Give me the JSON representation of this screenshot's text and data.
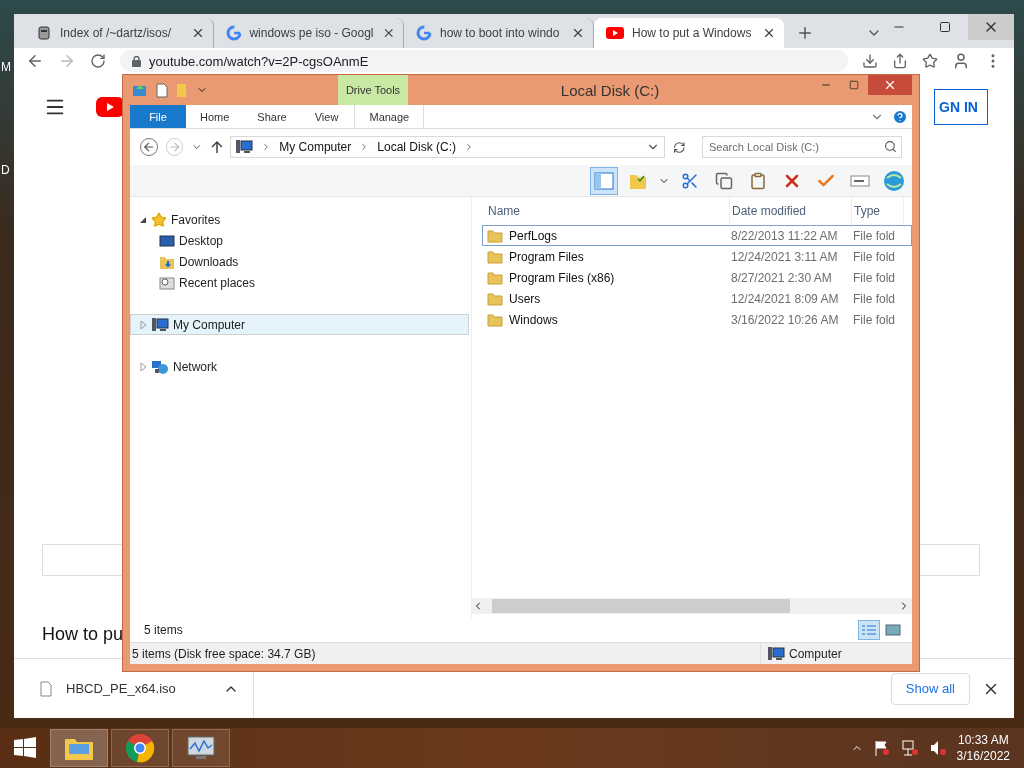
{
  "desktop_labels": [
    "M",
    "D"
  ],
  "browser": {
    "tabs": [
      {
        "title": "Index of /~dartz/isos/",
        "selected": false
      },
      {
        "title": "windows pe iso - Googl",
        "selected": false
      },
      {
        "title": "how to boot into windo",
        "selected": false
      },
      {
        "title": "How to put a Windows",
        "selected": true
      }
    ],
    "address": "youtube.com/watch?v=2P-cgsOAnmE",
    "sign_in": "GN IN",
    "heading": "How to pu",
    "downloads": {
      "file": "HBCD_PE_x64.iso",
      "show_all": "Show all"
    }
  },
  "explorer": {
    "title": "Local Disk (C:)",
    "context_group": "Drive Tools",
    "ribbon_tabs": [
      {
        "label": "File",
        "kind": "file",
        "selected": false
      },
      {
        "label": "Home",
        "kind": "tab",
        "selected": false
      },
      {
        "label": "Share",
        "kind": "tab",
        "selected": false
      },
      {
        "label": "View",
        "kind": "tab",
        "selected": false
      },
      {
        "label": "Manage",
        "kind": "contextual",
        "selected": false
      }
    ],
    "path": [
      "My Computer",
      "Local Disk (C:)"
    ],
    "search": {
      "placeholder": "Search Local Disk (C:)"
    },
    "nav": [
      {
        "label": "Favorites",
        "expanded": true,
        "selected": false,
        "children": [
          {
            "label": "Desktop",
            "selected": false
          },
          {
            "label": "Downloads",
            "selected": false
          },
          {
            "label": "Recent places",
            "selected": false
          }
        ]
      },
      {
        "label": "My Computer",
        "expanded": false,
        "selected": true
      },
      {
        "label": "Network",
        "expanded": false,
        "selected": false
      }
    ],
    "columns": [
      "Name",
      "Date modified",
      "Type"
    ],
    "files": [
      {
        "name": "PerfLogs",
        "date": "8/22/2013 11:22 AM",
        "type": "File fold",
        "selected": true
      },
      {
        "name": "Program Files",
        "date": "12/24/2021 3:11 AM",
        "type": "File fold",
        "selected": false
      },
      {
        "name": "Program Files (x86)",
        "date": "8/27/2021 2:30 AM",
        "type": "File fold",
        "selected": false
      },
      {
        "name": "Users",
        "date": "12/24/2021 8:09 AM",
        "type": "File fold",
        "selected": false
      },
      {
        "name": "Windows",
        "date": "3/16/2022 10:26 AM",
        "type": "File fold",
        "selected": false
      }
    ],
    "item_count": "5 items",
    "views": [
      {
        "kind": "details",
        "selected": true
      },
      {
        "kind": "tiles",
        "selected": false
      }
    ],
    "status": "5 items (Disk free space: 34.7 GB)",
    "status_location": "Computer"
  },
  "taskbar": {
    "apps": [
      {
        "kind": "explorer",
        "selected": true
      },
      {
        "kind": "chrome",
        "selected": false
      },
      {
        "kind": "monitor",
        "selected": false
      }
    ],
    "time": "10:33 AM",
    "date": "3/16/2022"
  }
}
